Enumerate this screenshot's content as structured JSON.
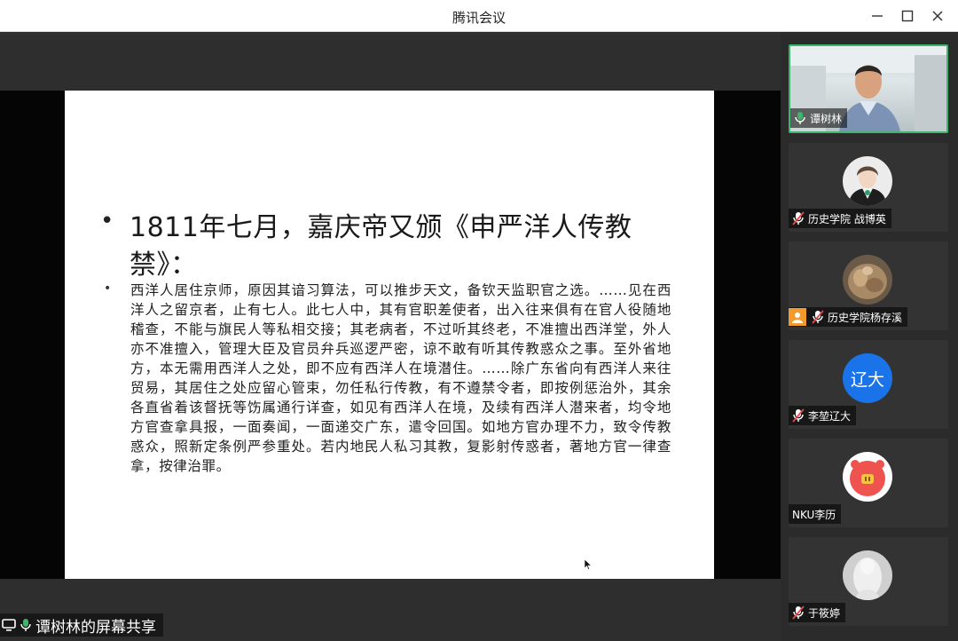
{
  "window": {
    "title": "腾讯会议"
  },
  "slide": {
    "title": "1811年七月，嘉庆帝又颁《申严洋人传教禁》：",
    "body": "西洋人居住京师，原因其谙习算法，可以推步天文，备钦天监职官之选。……见在西洋人之留京者，止有七人。此七人中，其有官职差使者，出入往来俱有在官人役随地稽查，不能与旗民人等私相交接；其老病者，不过听其终老，不准擅出西洋堂，外人亦不准擅入，管理大臣及官员弁兵巡逻严密，谅不敢有听其传教惑众之事。至外省地方，本无需用西洋人之处，即不应有西洋人在境潜住。……除广东省向有西洋人来往贸易，其居住之处应留心管束，勿任私行传教，有不遵禁令者，即按例惩治外，其余各直省着该督抚等饬属通行详查，如见有西洋人在境，及续有西洋人潜来者，均令地方官查拿具报，一面奏闻，一面递交广东，遣令回国。如地方官办理不力，致令传教惑众，照新定条例严参重处。若内地民人私习其教，复影射传惑者，著地方官一律查拿，按律治罪。"
  },
  "share_label": "谭树林的屏幕共享",
  "participants": [
    {
      "name": "谭树林",
      "mic": "on",
      "video": true
    },
    {
      "name": "历史学院 战博英",
      "mic": "muted"
    },
    {
      "name": "历史学院杨存溪",
      "mic": "muted",
      "badge": true
    },
    {
      "name": "李堃辽大",
      "mic": "muted",
      "avatar_text": "辽大"
    },
    {
      "name": "NKU李历",
      "mic": "none"
    },
    {
      "name": "于筱婷",
      "mic": "muted"
    }
  ],
  "colors": {
    "accent_green": "#3fb56b",
    "muted_red": "#e5484d",
    "avatar_blue": "#1a73e8",
    "badge_orange": "#f29b2c"
  }
}
